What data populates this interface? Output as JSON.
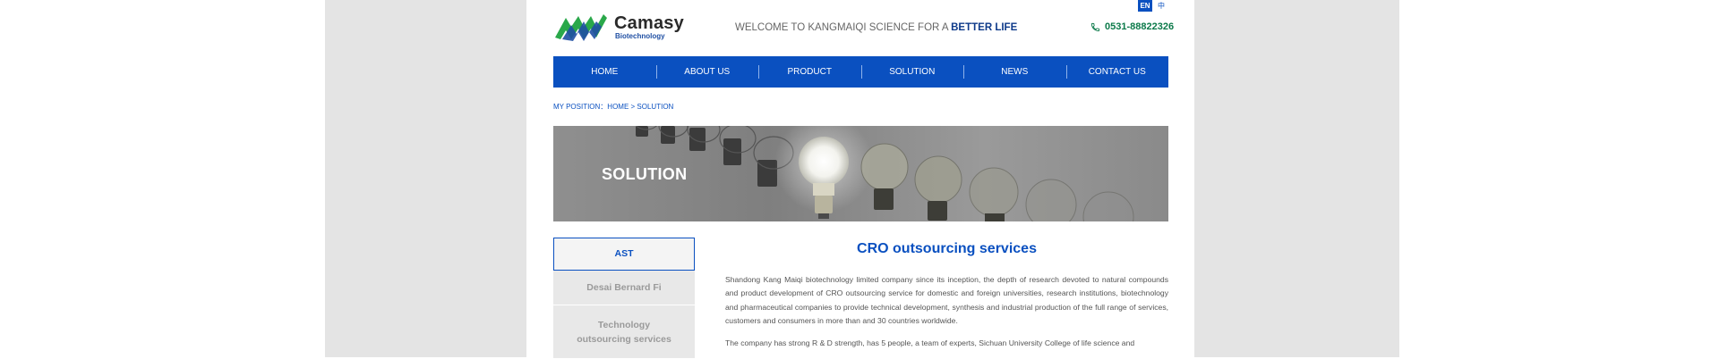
{
  "header": {
    "logo": {
      "brand": "Camasy",
      "subtitle": "Biotechnology"
    },
    "welcome_text": "WELCOME TO KANGMAIQI  SCIENCE FOR A ",
    "welcome_highlight": "BETTER LIFE",
    "phone": "0531-88822326",
    "lang": {
      "en": "EN",
      "cn": "中"
    }
  },
  "nav": [
    "HOME",
    "ABOUT US",
    "PRODUCT",
    "SOLUTION",
    "NEWS",
    "CONTACT US"
  ],
  "breadcrumb": "MY POSITION：HOME > SOLUTION",
  "banner": {
    "title": "SOLUTION"
  },
  "sidebar": [
    "AST",
    "Desai Bernard Fi",
    "Technology outsourcing services"
  ],
  "content": {
    "title": "CRO outsourcing services",
    "paragraphs": [
      "Shandong Kang Maiqi biotechnology limited company since its inception, the depth of research devoted to natural compounds and product development of CRO outsourcing service for domestic and foreign universities, research institutions, biotechnology and pharmaceutical companies to provide technical development, synthesis and industrial production of the full range of services, customers and consumers in more than and 30 countries worldwide.",
      "The company has strong R & D strength, has 5 people, a team of experts, Sichuan University College of life science and"
    ]
  },
  "colors": {
    "primary": "#0a50c0",
    "phone_green": "#0c7a4a",
    "side_bg": "#e8e8e8"
  }
}
